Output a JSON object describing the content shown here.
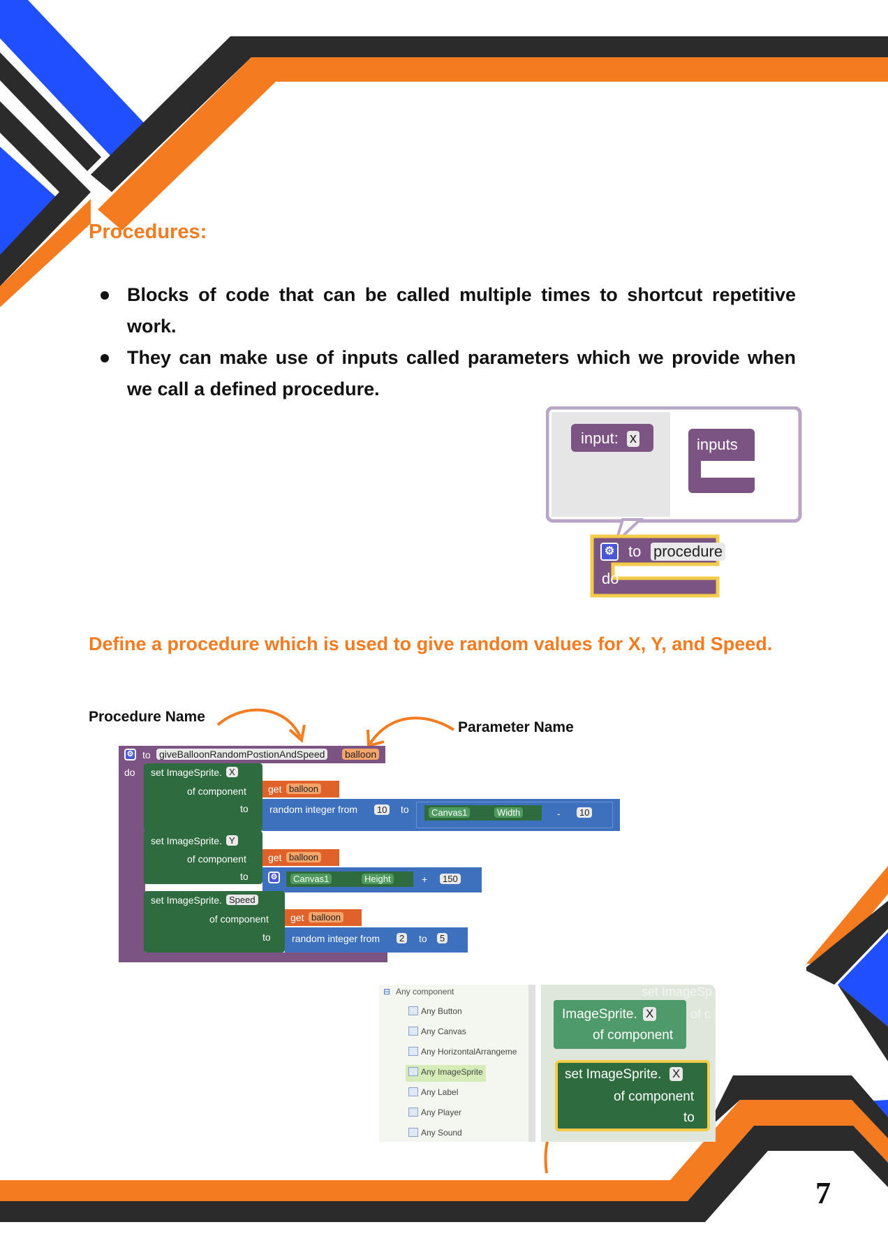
{
  "section_title": "Procedures:",
  "bullets": [
    "Blocks of code that can be called multiple times to shortcut repetitive work.",
    "They can make use of inputs called parameters which we provide when we call a defined procedure."
  ],
  "mutator_block": {
    "input_label": "input:",
    "input_value": "x",
    "inputs_label": "inputs",
    "to_label": "to",
    "procedure_name": "procedure",
    "do_label": "do"
  },
  "define_heading": "Define a procedure which is used to give random values for X, Y, and Speed.",
  "procedure_name_label": "Procedure Name",
  "parameter_name_label": "Parameter Name",
  "procedure_block": {
    "to_label": "to",
    "name": "giveBalloonRandomPostionAndSpeed",
    "param": "balloon",
    "do_label": "do",
    "set_label": "set ImageSprite.",
    "of_component": "of component",
    "to": "to",
    "get": "get",
    "get_var": "balloon",
    "prop_x": "X",
    "prop_y": "Y",
    "prop_speed": "Speed",
    "random_integer_from": "random integer from",
    "canvas1": "Canvas1",
    "width": "Width",
    "height": "Height",
    "minus": "-",
    "plus": "+",
    "n10a": "10",
    "n10b": "10",
    "n150": "150",
    "n2": "2",
    "n5": "5"
  },
  "component_list": {
    "header": "Any component",
    "items": [
      "Any Button",
      "Any Canvas",
      "Any HorizontalArrangeme",
      "Any ImageSprite",
      "Any Label",
      "Any Player",
      "Any Sound"
    ],
    "selected_index": 3,
    "ghost_text": "set ImageSp",
    "ghost_of": "of c",
    "getter_label": "ImageSprite.",
    "getter_prop": "X",
    "getter_of": "of component",
    "setter_label": "set ImageSprite.",
    "setter_prop": "X",
    "setter_of": "of component",
    "setter_to": "to"
  },
  "page_number": "7",
  "colors": {
    "orange": "#f47b20",
    "blue": "#1f4fff",
    "dark": "#2b2b2b",
    "procedure_purple": "#7b5484",
    "component_green": "#2e6b3f",
    "math_blue": "#3d70bd",
    "variable_orange": "#e0622a"
  }
}
